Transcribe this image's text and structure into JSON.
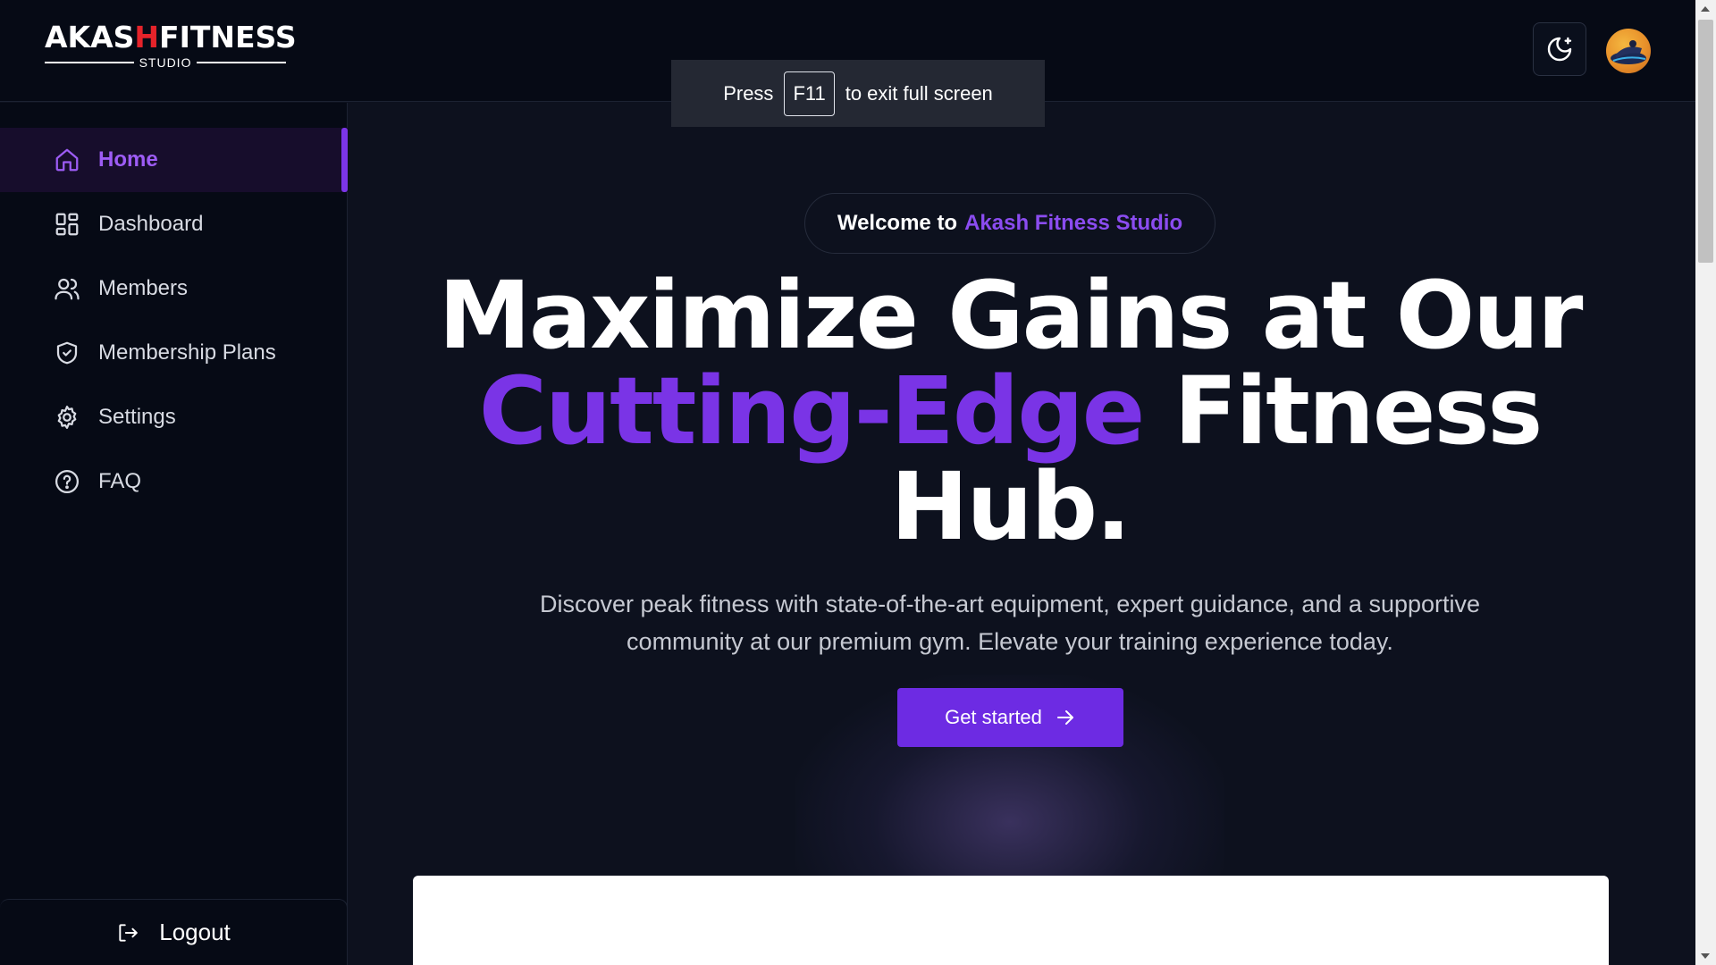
{
  "header": {
    "logo": {
      "part1": "AKAS",
      "part2": "H",
      "part3": "FITNESS",
      "sub": "STUDIO"
    },
    "theme_icon": "moon-star-icon",
    "avatar_icon": "user-avatar"
  },
  "toast": {
    "before": "Press",
    "key": "F11",
    "after": "to exit full screen"
  },
  "sidebar": {
    "items": [
      {
        "label": "Home",
        "icon": "home-icon",
        "active": true
      },
      {
        "label": "Dashboard",
        "icon": "grid-icon"
      },
      {
        "label": "Members",
        "icon": "users-icon"
      },
      {
        "label": "Membership Plans",
        "icon": "shield-check-icon"
      },
      {
        "label": "Settings",
        "icon": "gear-icon"
      },
      {
        "label": "FAQ",
        "icon": "question-icon"
      }
    ],
    "logout": "Logout"
  },
  "hero": {
    "welcome_prefix": "Welcome to",
    "welcome_brand": "Akash Fitness Studio",
    "headline_line1": "Maximize Gains at Our",
    "headline_purple": "Cutting-Edge",
    "headline_rest": " Fitness",
    "headline_line3": "Hub.",
    "subtext": "Discover peak fitness with state-of-the-art equipment, expert guidance, and a supportive community at our premium gym. Elevate your training experience today.",
    "cta": "Get started"
  },
  "colors": {
    "accent": "#7a34e6",
    "brand_red": "#e5232a",
    "bg": "#0d111e"
  }
}
